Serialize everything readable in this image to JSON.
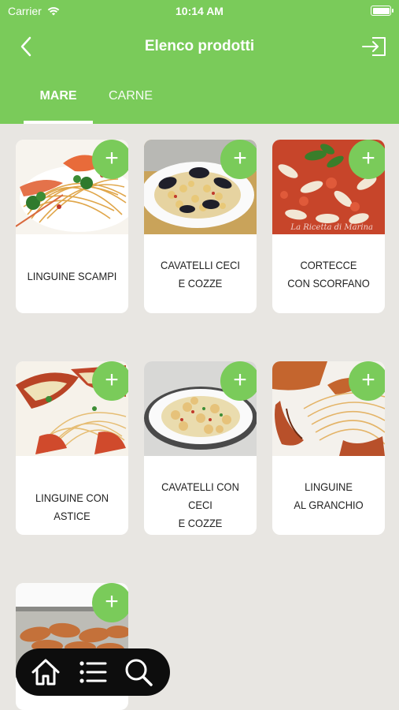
{
  "status_bar": {
    "carrier": "Carrier",
    "time": "10:14 AM"
  },
  "nav": {
    "title": "Elenco prodotti",
    "back_icon": "chevron-left-icon",
    "logout_icon": "logout-icon"
  },
  "tabs": [
    {
      "label": "MARE",
      "selected": true
    },
    {
      "label": "CARNE",
      "selected": false
    }
  ],
  "products": [
    {
      "label_line1": "LINGUINE SCAMPI",
      "label_line2": "",
      "add": "+"
    },
    {
      "label_line1": "CAVATELLI CECI",
      "label_line2": "E COZZE",
      "add": "+"
    },
    {
      "label_line1": "CORTECCE",
      "label_line2": "CON SCORFANO",
      "add": "+",
      "watermark": "La Ricetta di Marina"
    },
    {
      "label_line1": "LINGUINE CON ASTICE",
      "label_line2": "",
      "add": "+"
    },
    {
      "label_line1": "CAVATELLI CON CECI",
      "label_line2": "E COZZE",
      "add": "+"
    },
    {
      "label_line1": "LINGUINE",
      "label_line2": "AL GRANCHIO",
      "add": "+"
    },
    {
      "label_line1": "",
      "label_line2": "",
      "add": "+"
    }
  ],
  "bottom_bar": {
    "icons": [
      "home-icon",
      "list-icon",
      "search-icon"
    ]
  },
  "colors": {
    "brand_green": "#7acb5a",
    "background": "#e8e6e2",
    "bar": "#0d0d0d"
  }
}
